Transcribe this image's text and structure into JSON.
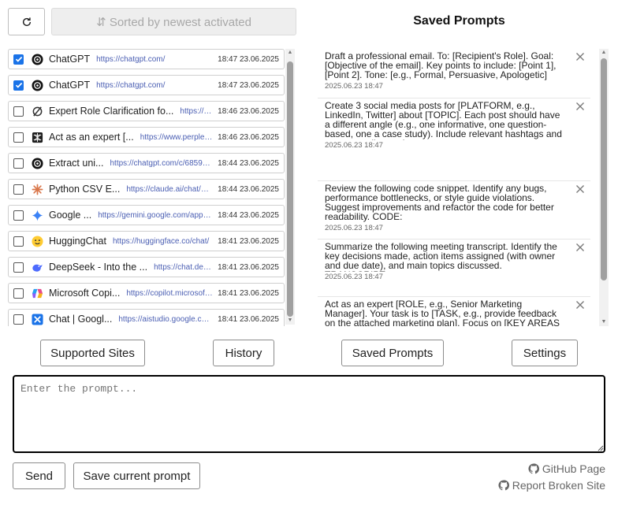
{
  "toolbar": {
    "refresh_icon": "refresh-icon",
    "sort_label": "⇵ Sorted by newest activated"
  },
  "history": [
    {
      "checked": true,
      "icon": "chatgpt-icon",
      "title": "ChatGPT",
      "url": "https://chatgpt.com/",
      "time": "18:47 23.06.2025"
    },
    {
      "checked": true,
      "icon": "chatgpt-icon",
      "title": "ChatGPT",
      "url": "https://chatgpt.com/",
      "time": "18:47 23.06.2025"
    },
    {
      "checked": false,
      "icon": "grok-icon",
      "title": "Expert Role Clarification fo...",
      "url": "https://gro...",
      "time": "18:46 23.06.2025"
    },
    {
      "checked": false,
      "icon": "perplexity-icon",
      "title": "Act as an expert [...",
      "url": "https://www.perplexity....",
      "time": "18:46 23.06.2025"
    },
    {
      "checked": false,
      "icon": "chatgpt-icon",
      "title": "Extract uni...",
      "url": "https://chatgpt.com/c/685976...",
      "time": "18:44 23.06.2025"
    },
    {
      "checked": false,
      "icon": "claude-icon",
      "title": "Python CSV E...",
      "url": "https://claude.ai/chat/b6b...",
      "time": "18:44 23.06.2025"
    },
    {
      "checked": false,
      "icon": "gemini-icon",
      "title": "Google ...",
      "url": "https://gemini.google.com/app/6...",
      "time": "18:44 23.06.2025"
    },
    {
      "checked": false,
      "icon": "huggingface-icon",
      "title": "HuggingChat",
      "url": "https://huggingface.co/chat/",
      "time": "18:41 23.06.2025"
    },
    {
      "checked": false,
      "icon": "deepseek-icon",
      "title": "DeepSeek - Into the ...",
      "url": "https://chat.deeps...",
      "time": "18:41 23.06.2025"
    },
    {
      "checked": false,
      "icon": "copilot-icon",
      "title": "Microsoft Copi...",
      "url": "https://copilot.microsoft.c...",
      "time": "18:41 23.06.2025"
    },
    {
      "checked": false,
      "icon": "aistudio-icon",
      "title": "Chat | Googl...",
      "url": "https://aistudio.google.com...",
      "time": "18:41 23.06.2025"
    }
  ],
  "saved": {
    "title": "Saved Prompts",
    "items": [
      {
        "text": "Draft a professional email. To: [Recipient's Role]. Goal: [Objective of the email]. Key points to include: [Point 1], [Point 2]. Tone: [e.g., Formal, Persuasive, Apologetic]",
        "date": ""
      },
      {
        "text": "Create 3 social media posts for [PLATFORM, e.g., LinkedIn, Twitter] about [TOPIC]. Each post should have a different angle (e.g., one informative, one question-based, one a case study). Include relevant hashtags and a strong call-to-action.",
        "date": "2025.06.23 18:47"
      },
      {
        "text": "Review the following code snippet. Identify any bugs, performance bottlenecks, or style guide violations. Suggest improvements and refactor the code for better readability. CODE:",
        "date": "2025.06.23 18:47"
      },
      {
        "text": "Summarize the following meeting transcript. Identify the key decisions made, action items assigned (with owner and due date), and main topics discussed. TRANSCRIPT:",
        "date": "2025.06.23 18:47"
      },
      {
        "text": "Act as an expert [ROLE, e.g., Senior Marketing Manager]. Your task is to [TASK, e.g., provide feedback on the attached marketing plan]. Focus on [KEY AREAS",
        "date": ""
      }
    ],
    "first_date": "2025.06.23 18:47"
  },
  "nav": {
    "supported_sites": "Supported Sites",
    "history": "History",
    "saved_prompts": "Saved Prompts",
    "settings": "Settings"
  },
  "prompt": {
    "placeholder": "Enter the prompt..."
  },
  "actions": {
    "send": "Send",
    "save_current": "Save current prompt"
  },
  "footer": {
    "github": "GitHub Page",
    "report": "Report Broken Site"
  }
}
